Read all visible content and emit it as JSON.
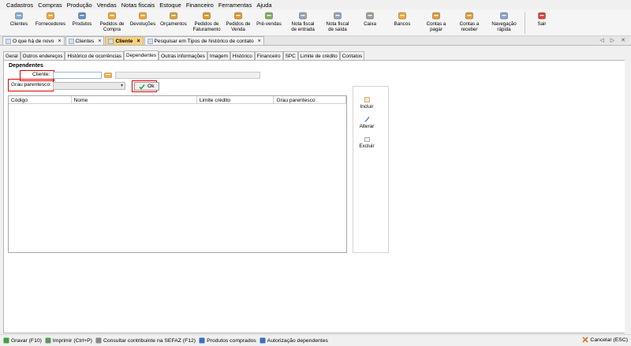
{
  "menu": [
    "Cadastros",
    "Compras",
    "Produção",
    "Vendas",
    "Notas fiscais",
    "Estoque",
    "Financeiro",
    "Ferramentas",
    "Ajuda"
  ],
  "toolbar": [
    {
      "label": "Clientes",
      "icon": "clients-icon",
      "w": 36
    },
    {
      "label": "Fornecedores",
      "icon": "suppliers-icon",
      "w": 44
    },
    {
      "label": "Produtos",
      "icon": "products-icon",
      "w": 36
    },
    {
      "label": "Pedidos de\nCompra",
      "icon": "purchase-orders-icon",
      "w": 40
    },
    {
      "label": "Devoluções",
      "icon": "returns-icon",
      "w": 38
    },
    {
      "label": "Orçamentos",
      "icon": "quotes-icon",
      "w": 40
    },
    {
      "label": "Pedidos de\nFaturamento",
      "icon": "billing-orders-icon",
      "w": 44
    },
    {
      "label": "Pedidos de\nVenda",
      "icon": "sales-orders-icon",
      "w": 36
    },
    {
      "label": "Pré-vendas",
      "icon": "pre-sales-icon",
      "w": 42
    },
    {
      "label": "Nota fiscal\nde entrada",
      "icon": "incoming-invoice-icon",
      "w": 44
    },
    {
      "label": "Nota fiscal\nde saída",
      "icon": "outgoing-invoice-icon",
      "w": 44
    },
    {
      "label": "Caixa",
      "icon": "cashier-icon",
      "w": 38
    },
    {
      "label": "Bancos",
      "icon": "banks-icon",
      "w": 44
    },
    {
      "label": "Contas a\npagar",
      "icon": "payables-icon",
      "w": 42
    },
    {
      "label": "Contas a\nreceber",
      "icon": "receivables-icon",
      "w": 42
    },
    {
      "label": "Navegação\nrápida",
      "icon": "quick-nav-icon",
      "w": 46
    },
    {
      "label": "Sair",
      "icon": "exit-icon",
      "w": 36
    }
  ],
  "doc_tabs": [
    {
      "label": "O que há de novo",
      "active": false
    },
    {
      "label": "Clientes",
      "active": false
    },
    {
      "label": "Cliente",
      "active": true
    },
    {
      "label": "Pesquisar em Tipos de histórico de contato",
      "active": false
    }
  ],
  "tab_nav": "◁ ▷ ✕",
  "sub_tabs": [
    {
      "label": "Geral",
      "active": false
    },
    {
      "label": "Outros endereços",
      "active": false
    },
    {
      "label": "Histórico de ocorrências",
      "active": false
    },
    {
      "label": "Dependentes",
      "active": true
    },
    {
      "label": "Outras informações",
      "active": false
    },
    {
      "label": "Imagem",
      "active": false
    },
    {
      "label": "Histórico",
      "active": false
    },
    {
      "label": "Financeiro",
      "active": false
    },
    {
      "label": "SPC",
      "active": false
    },
    {
      "label": "Limite de crédito",
      "active": false
    },
    {
      "label": "Contatos",
      "active": false
    }
  ],
  "section_title": "Dependentes",
  "form": {
    "cliente_label": "Cliente:",
    "cliente_value": "",
    "cliente_name_value": "",
    "grau_label": "Grau parentesco:",
    "grau_value": "",
    "ok_label": "Ok"
  },
  "grid": {
    "columns": [
      "Código",
      "Nome",
      "Limite crédito",
      "Grau parentesco"
    ]
  },
  "side_buttons": [
    {
      "label": "Incluir",
      "icon": "add-icon"
    },
    {
      "label": "Alterar",
      "icon": "edit-icon"
    },
    {
      "label": "Excluir",
      "icon": "delete-icon"
    }
  ],
  "bottom_buttons": [
    {
      "label": "Gravar (F10)",
      "icon": "save-icon"
    },
    {
      "label": "Imprimir (Ctrl+P)",
      "icon": "print-icon"
    },
    {
      "label": "Consultar contribuinte na SEFAZ (F12)",
      "icon": "sefaz-icon"
    },
    {
      "label": "Produtos comprados",
      "icon": "purchased-products-icon"
    },
    {
      "label": "Autorização dependentes",
      "icon": "authorization-icon"
    }
  ],
  "cancel_label": "Cancelar (ESC)",
  "colors": {
    "active_tab": "#fbd27a",
    "highlight": "#e00000",
    "ok_check": "#3aa13a"
  }
}
